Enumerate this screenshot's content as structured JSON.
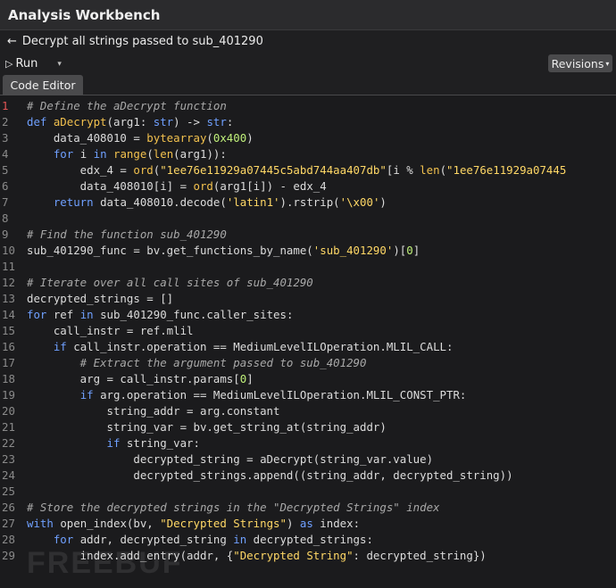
{
  "window": {
    "title": "Analysis Workbench"
  },
  "header": {
    "back_icon": "←",
    "title": "Decrypt all strings passed to sub_401290"
  },
  "toolbar": {
    "run_icon": "▷",
    "run_label": "Run",
    "run_menu_icon": "▾",
    "revisions_label": "Revisions",
    "revisions_caret": "▾"
  },
  "tabs": [
    {
      "label": "Code Editor",
      "active": true
    }
  ],
  "colors": {
    "comment": "#a8a8a8",
    "keyword": "#6fa0ff",
    "function": "#f2c14e",
    "string": "#ffd866",
    "number": "#c0f07a",
    "text": "#dcdcdc"
  },
  "editor": {
    "lines": [
      [
        [
          "c",
          "# Define the aDecrypt function"
        ]
      ],
      [
        [
          "k",
          "def "
        ],
        [
          "f",
          "aDecrypt"
        ],
        [
          "t",
          "(arg1: "
        ],
        [
          "k",
          "str"
        ],
        [
          "t",
          ") -> "
        ],
        [
          "k",
          "str"
        ],
        [
          "t",
          ":"
        ]
      ],
      [
        [
          "t",
          "    data_408010 = "
        ],
        [
          "f",
          "bytearray"
        ],
        [
          "t",
          "("
        ],
        [
          "n",
          "0x400"
        ],
        [
          "t",
          ")"
        ]
      ],
      [
        [
          "t",
          "    "
        ],
        [
          "k",
          "for "
        ],
        [
          "t",
          "i "
        ],
        [
          "k",
          "in "
        ],
        [
          "f",
          "range"
        ],
        [
          "t",
          "("
        ],
        [
          "f",
          "len"
        ],
        [
          "t",
          "(arg1)):"
        ]
      ],
      [
        [
          "t",
          "        edx_4 = "
        ],
        [
          "f",
          "ord"
        ],
        [
          "t",
          "("
        ],
        [
          "s",
          "\"1ee76e11929a07445c5abd744aa407db\""
        ],
        [
          "t",
          "[i % "
        ],
        [
          "f",
          "len"
        ],
        [
          "t",
          "("
        ],
        [
          "s",
          "\"1ee76e11929a07445"
        ]
      ],
      [
        [
          "t",
          "        data_408010[i] = "
        ],
        [
          "f",
          "ord"
        ],
        [
          "t",
          "(arg1[i]) - edx_4"
        ]
      ],
      [
        [
          "t",
          "    "
        ],
        [
          "k",
          "return "
        ],
        [
          "t",
          "data_408010.decode("
        ],
        [
          "s",
          "'latin1'"
        ],
        [
          "t",
          ").rstrip("
        ],
        [
          "s",
          "'\\x00'"
        ],
        [
          "t",
          ")"
        ]
      ],
      [],
      [
        [
          "c",
          "# Find the function sub_401290"
        ]
      ],
      [
        [
          "t",
          "sub_401290_func = bv.get_functions_by_name("
        ],
        [
          "s",
          "'sub_401290'"
        ],
        [
          "t",
          ")["
        ],
        [
          "n",
          "0"
        ],
        [
          "t",
          "]"
        ]
      ],
      [],
      [
        [
          "c",
          "# Iterate over all call sites of sub_401290"
        ]
      ],
      [
        [
          "t",
          "decrypted_strings = []"
        ]
      ],
      [
        [
          "k",
          "for "
        ],
        [
          "t",
          "ref "
        ],
        [
          "k",
          "in "
        ],
        [
          "t",
          "sub_401290_func.caller_sites:"
        ]
      ],
      [
        [
          "t",
          "    call_instr = ref.mlil"
        ]
      ],
      [
        [
          "t",
          "    "
        ],
        [
          "k",
          "if "
        ],
        [
          "t",
          "call_instr.operation == MediumLevelILOperation.MLIL_CALL:"
        ]
      ],
      [
        [
          "c",
          "        # Extract the argument passed to sub_401290"
        ]
      ],
      [
        [
          "t",
          "        arg = call_instr.params["
        ],
        [
          "n",
          "0"
        ],
        [
          "t",
          "]"
        ]
      ],
      [
        [
          "t",
          "        "
        ],
        [
          "k",
          "if "
        ],
        [
          "t",
          "arg.operation == MediumLevelILOperation.MLIL_CONST_PTR:"
        ]
      ],
      [
        [
          "t",
          "            string_addr = arg.constant"
        ]
      ],
      [
        [
          "t",
          "            string_var = bv.get_string_at(string_addr)"
        ]
      ],
      [
        [
          "t",
          "            "
        ],
        [
          "k",
          "if "
        ],
        [
          "t",
          "string_var:"
        ]
      ],
      [
        [
          "t",
          "                decrypted_string = aDecrypt(string_var.value)"
        ]
      ],
      [
        [
          "t",
          "                decrypted_strings.append((string_addr, decrypted_string))"
        ]
      ],
      [],
      [
        [
          "c",
          "# Store the decrypted strings in the \"Decrypted Strings\" index"
        ]
      ],
      [
        [
          "k",
          "with "
        ],
        [
          "t",
          "open_index(bv, "
        ],
        [
          "s",
          "\"Decrypted Strings\""
        ],
        [
          "t",
          ") "
        ],
        [
          "k",
          "as "
        ],
        [
          "t",
          "index:"
        ]
      ],
      [
        [
          "t",
          "    "
        ],
        [
          "k",
          "for "
        ],
        [
          "t",
          "addr, decrypted_string "
        ],
        [
          "k",
          "in "
        ],
        [
          "t",
          "decrypted_strings:"
        ]
      ],
      [
        [
          "t",
          "        index.add_entry(addr, {"
        ],
        [
          "s",
          "\"Decrypted String\""
        ],
        [
          "t",
          ": decrypted_string})"
        ]
      ]
    ]
  },
  "watermark": "FREEBUF"
}
